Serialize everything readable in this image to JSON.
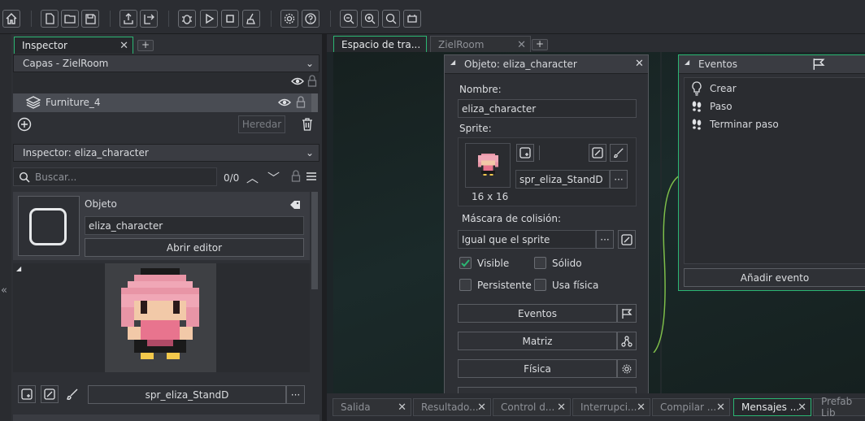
{
  "toolbar": {
    "icons": [
      "home-icon",
      "new-file-icon",
      "open-folder-icon",
      "save-icon",
      "export-icon",
      "export-alt-icon",
      "debug-icon",
      "play-icon",
      "stop-icon",
      "clean-icon",
      "settings-icon",
      "help-icon",
      "zoom-out-icon",
      "zoom-in-icon",
      "zoom-reset-icon",
      "gamepad-icon"
    ]
  },
  "left": {
    "tab_label": "Inspector",
    "layers_header": "Capas - ZielRoom",
    "layer_item": "Furniture_4",
    "inherit_button": "Heredar",
    "inspector_header": "Inspector: eliza_character",
    "search_placeholder": "Buscar...",
    "search_count": "0/0",
    "object_label": "Objeto",
    "object_name": "eliza_character",
    "open_editor": "Abrir editor",
    "sprite_name": "spr_eliza_StandD"
  },
  "workspace": {
    "tab1": "Espacio de tra...",
    "tab2": "ZielRoom"
  },
  "object_editor": {
    "title": "Objeto: eliza_character",
    "name_label": "Nombre:",
    "name_value": "eliza_character",
    "sprite_label": "Sprite:",
    "sprite_value": "spr_eliza_StandD",
    "sprite_size": "16 x 16",
    "mask_label": "Máscara de colisión:",
    "mask_value": "Igual que el sprite",
    "visible": "Visible",
    "solid": "Sólido",
    "persistent": "Persistente",
    "physics_use": "Usa física",
    "events_btn": "Eventos",
    "matrix_btn": "Matriz",
    "physics_btn": "Física"
  },
  "events": {
    "title": "Eventos",
    "items": [
      "Crear",
      "Paso",
      "Terminar paso"
    ],
    "add": "Añadir evento"
  },
  "bottom_tabs": [
    "Salida",
    "Resultado...",
    "Control d...",
    "Interrupci...",
    "Compilar ...",
    "Mensajes ...",
    "Prefab Lib"
  ],
  "colors": {
    "accent": "#2bb673",
    "panel": "#2e3035",
    "dark": "#26282d"
  }
}
